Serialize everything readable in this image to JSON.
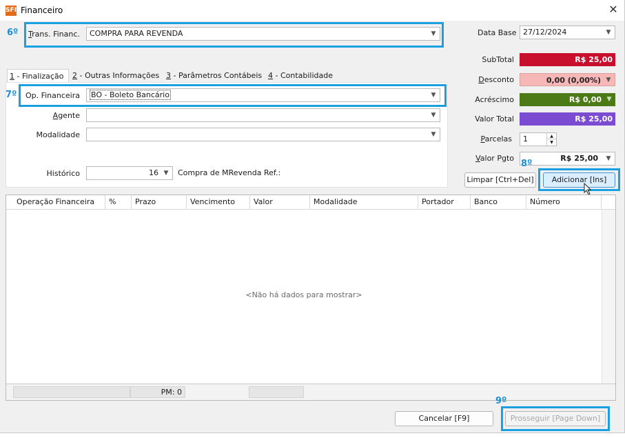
{
  "window": {
    "title": "Financeiro",
    "app_icon_text": "SFI",
    "close_glyph": "✕"
  },
  "annotations": {
    "a6": "6º",
    "a7": "7º",
    "a8": "8º",
    "a9": "9º"
  },
  "trans": {
    "label_u": "T",
    "label_rest": "rans. Financ.",
    "value": "COMPRA PARA REVENDA"
  },
  "tabs": [
    {
      "num": "1",
      "label": " - Finalização"
    },
    {
      "num": "2",
      "label": " - Outras Informações"
    },
    {
      "num": "3",
      "label": " - Parâmetros Contábeis"
    },
    {
      "num": "4",
      "label": " - Contabilidade"
    }
  ],
  "form": {
    "op_label": "Op. Financeira",
    "op_value": "BO - Boleto Bancário",
    "agente_u": "A",
    "agente_rest": "gente",
    "agente_value": "",
    "modalidade_label": "Modalidade",
    "modalidade_value": "",
    "historico_label": "Histórico",
    "historico_value": "16",
    "historico_desc": "Compra de MRevenda Ref.:"
  },
  "totals": {
    "data_base_label": "Data Base",
    "data_base_value": "27/12/2024",
    "subtotal_label": "SubTotal",
    "subtotal_value": "R$ 25,00",
    "desconto_u": "D",
    "desconto_rest": "esconto",
    "desconto_value": "0,00 (0,00%)",
    "acrescimo_label": "Acréscimo",
    "acrescimo_value": "R$ 0,00",
    "valor_total_label": "Valor Total",
    "valor_total_value": "R$ 25,00",
    "parcelas_u": "P",
    "parcelas_rest": "arcelas",
    "parcelas_value": "1",
    "valor_pgto_u": "V",
    "valor_pgto_rest": "alor Pgto",
    "valor_pgto_value": "R$ 25,00"
  },
  "buttons": {
    "limpar": "Limpar [Ctrl+Del]",
    "adicionar": "Adicionar [Ins]",
    "cancelar": "Cancelar [F9]",
    "prosseguir": "Prosseguir [Page Down]"
  },
  "grid": {
    "columns": [
      "Operação Financeira",
      "%",
      "Prazo",
      "Vencimento",
      "Valor",
      "Modalidade",
      "Portador",
      "Banco",
      "Número"
    ],
    "empty_text": "<Não há dados para mostrar>",
    "pm_label": "PM: 0"
  },
  "colors": {
    "subtotal": "#c8102e",
    "desconto": "#f7b7b7",
    "acrescimo": "#4b7a17",
    "valor_total": "#7b4bd1",
    "highlight": "#1aa0e0"
  }
}
